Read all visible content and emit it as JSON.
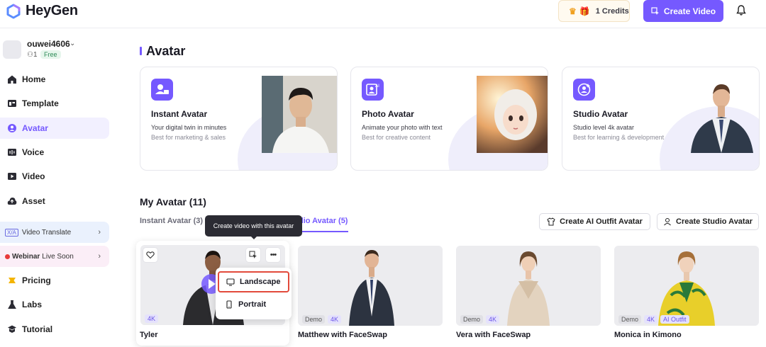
{
  "app": {
    "name": "HeyGen"
  },
  "header": {
    "credits_label": "1 Credits",
    "create_video_label": "Create Video"
  },
  "user": {
    "name": "ouwei4606",
    "members": "1",
    "plan": "Free"
  },
  "sidebar": {
    "items": [
      {
        "label": "Home",
        "icon": "home-icon"
      },
      {
        "label": "Template",
        "icon": "template-icon"
      },
      {
        "label": "Avatar",
        "icon": "avatar-icon",
        "active": true
      },
      {
        "label": "Voice",
        "icon": "voice-icon"
      },
      {
        "label": "Video",
        "icon": "video-icon"
      },
      {
        "label": "Asset",
        "icon": "asset-icon"
      }
    ],
    "promos": [
      {
        "badge": "X/A",
        "label": "Video Translate"
      },
      {
        "label_bold": "Webinar",
        "label": "Live Soon"
      }
    ],
    "bottom_items": [
      {
        "label": "Pricing",
        "icon": "pricing-icon"
      },
      {
        "label": "Labs",
        "icon": "labs-icon"
      },
      {
        "label": "Tutorial",
        "icon": "tutorial-icon"
      }
    ]
  },
  "main": {
    "title": "Avatar",
    "cards": [
      {
        "title": "Instant Avatar",
        "subtitle": "Your digital twin in minutes",
        "note": "Best for marketing & sales"
      },
      {
        "title": "Photo Avatar",
        "subtitle": "Animate your photo with text",
        "note": "Best for creative content"
      },
      {
        "title": "Studio Avatar",
        "subtitle": "Studio level 4k avatar",
        "note": "Best for learning & development"
      }
    ],
    "my_avatar_title": "My Avatar (11)",
    "tabs": [
      {
        "label": "Instant Avatar (3)"
      },
      {
        "label": "dio Avatar (5)",
        "active": true
      }
    ],
    "actions": {
      "outfit_label": "Create AI Outfit Avatar",
      "studio_label": "Create Studio Avatar"
    },
    "tooltip": "Create video with this avatar",
    "menu": {
      "landscape": "Landscape",
      "portrait": "Portrait"
    },
    "avatars": [
      {
        "name": "Tyler",
        "tags": [
          "4K"
        ]
      },
      {
        "name": "Matthew with FaceSwap",
        "tags": [
          "Demo",
          "4K"
        ]
      },
      {
        "name": "Vera with FaceSwap",
        "tags": [
          "Demo",
          "4K"
        ]
      },
      {
        "name": "Monica in Kimono",
        "tags": [
          "Demo",
          "4K",
          "AI Outfit"
        ]
      }
    ]
  },
  "colors": {
    "accent": "#7559ff",
    "highlight": "#e24a3b"
  }
}
